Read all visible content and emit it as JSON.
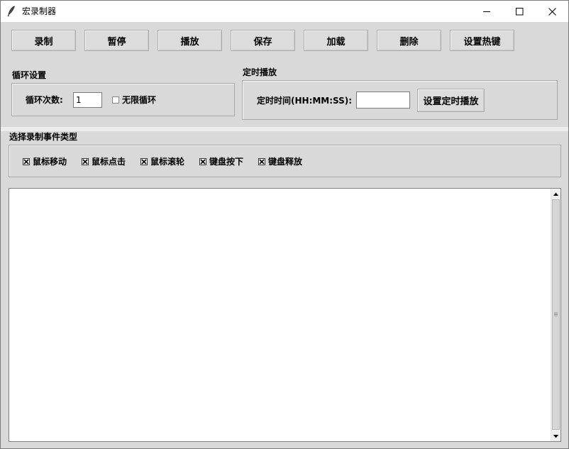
{
  "window": {
    "title": "宏录制器",
    "icon": "feather-icon"
  },
  "toolbar": {
    "record": "录制",
    "pause": "暂停",
    "play": "播放",
    "save": "保存",
    "load": "加载",
    "delete": "删除",
    "hotkey": "设置热键"
  },
  "loop": {
    "group_title": "循环设置",
    "count_label": "循环次数:",
    "count_value": "1",
    "infinite_label": "无限循环",
    "infinite_checked": false
  },
  "schedule": {
    "group_title": "定时播放",
    "time_label": "定时时间(HH:MM:SS):",
    "time_value": "",
    "set_button": "设置定时播放"
  },
  "events": {
    "group_title": "选择录制事件类型",
    "items": [
      {
        "label": "鼠标移动",
        "checked": true
      },
      {
        "label": "鼠标点击",
        "checked": true
      },
      {
        "label": "鼠标滚轮",
        "checked": true
      },
      {
        "label": "键盘按下",
        "checked": true
      },
      {
        "label": "键盘释放",
        "checked": true
      }
    ]
  },
  "log": {
    "content": ""
  }
}
